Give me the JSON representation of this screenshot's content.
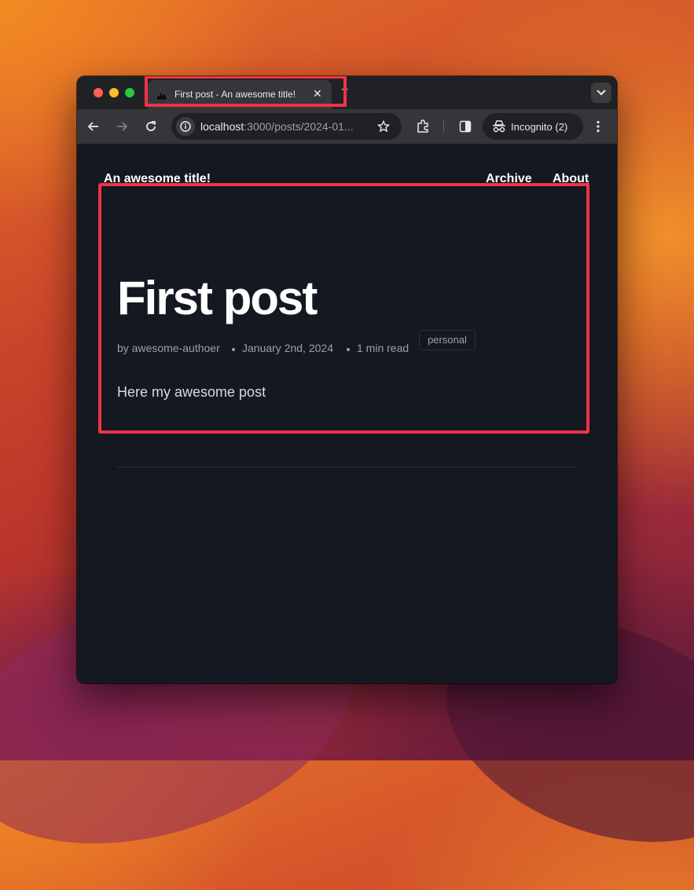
{
  "browser": {
    "tab": {
      "title": "First post - An awesome title!",
      "close_glyph": "✕"
    },
    "new_tab_glyph": "+",
    "address_bar": {
      "url_host": "localhost",
      "url_rest": ":3000/posts/2024-01..."
    },
    "profile": {
      "label": "Incognito (2)"
    }
  },
  "site": {
    "title": "An awesome title!",
    "nav": [
      {
        "label": "Archive"
      },
      {
        "label": "About"
      }
    ]
  },
  "post": {
    "title": "First post",
    "author": "by awesome-authoer",
    "date": "January 2nd, 2024",
    "read_time": "1 min read",
    "tag": "personal",
    "body": "Here my awesome post"
  },
  "colors": {
    "highlight": "#ef3348",
    "page_background": "#141820",
    "toolbar": "#35363a",
    "titlebar": "#202124"
  },
  "icons": [
    "info-icon",
    "star-icon",
    "extensions-icon",
    "side-panel-icon",
    "incognito-icon",
    "more-menu-icon",
    "back-icon",
    "forward-icon",
    "reload-icon",
    "tab-search-icon",
    "favicon-icon"
  ]
}
